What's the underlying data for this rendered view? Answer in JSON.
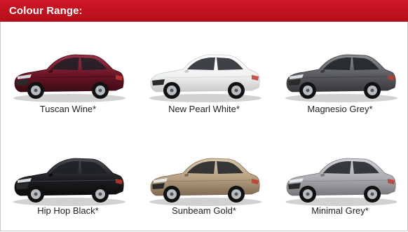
{
  "header": {
    "title": "Colour Range:"
  },
  "colors": [
    {
      "name": "Tuscan Wine*",
      "body": "#6a1526",
      "shade": "#3a0a14",
      "light": "#9a3347"
    },
    {
      "name": "New Pearl White*",
      "body": "#f2f2f2",
      "shade": "#c9c9c9",
      "light": "#ffffff"
    },
    {
      "name": "Magnesio Grey*",
      "body": "#5a5c60",
      "shade": "#35373a",
      "light": "#8a8d92"
    },
    {
      "name": "Hip Hop Black*",
      "body": "#1e1f22",
      "shade": "#0c0c0e",
      "light": "#4b4d52"
    },
    {
      "name": "Sunbeam Gold*",
      "body": "#b59e7f",
      "shade": "#7e6a51",
      "light": "#d8c6ac"
    },
    {
      "name": "Minimal Grey*",
      "body": "#a9abae",
      "shade": "#75777a",
      "light": "#d1d3d6"
    }
  ],
  "theme": {
    "header_bg": "#c1121f",
    "header_text": "#ffffff"
  }
}
